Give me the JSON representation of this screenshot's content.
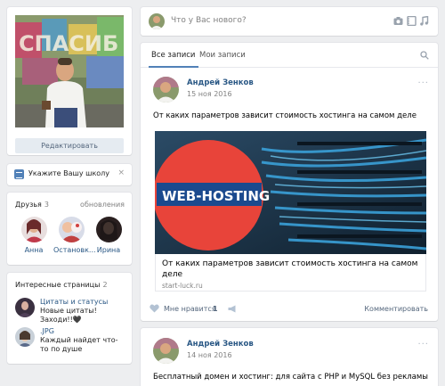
{
  "sidebar": {
    "edit_button": "Редактировать",
    "school_prompt": "Укажите Вашу школу",
    "school_close": "×",
    "friends": {
      "title": "Друзья",
      "count": "3",
      "updates": "обновления",
      "items": [
        {
          "name": "Анна"
        },
        {
          "name": "Остановк..."
        },
        {
          "name": "Ирина"
        }
      ]
    },
    "pages": {
      "title": "Интересные страницы",
      "count": "2",
      "items": [
        {
          "title": "Цитаты и статусы",
          "desc": "Новые цитаты!Заходи!!🖤"
        },
        {
          "title": ".JPG",
          "desc": "Каждый найдет что-то по душе"
        }
      ]
    }
  },
  "postbox": {
    "placeholder": "Что у Вас нового?",
    "icons": [
      "camera-icon",
      "video-icon",
      "music-icon",
      "more-icon"
    ]
  },
  "feed": {
    "tabs": [
      {
        "label": "Все записи",
        "active": true
      },
      {
        "label": "Мои записи",
        "active": false
      }
    ]
  },
  "posts": [
    {
      "author": "Андрей Зенков",
      "date": "15 ноя 2016",
      "more": "···",
      "text": "От каких параметров зависит стоимость хостинга на самом деле",
      "link": {
        "image_text": "WEB-HOSTING",
        "title": "От каких параметров зависит стоимость хостинга на самом деле",
        "domain": "start-luck.ru"
      },
      "likes_label": "Мне нравится",
      "likes_count": "1",
      "comment_label": "Комментировать"
    },
    {
      "author": "Андрей Зенков",
      "date": "14 ноя 2016",
      "more": "···",
      "text": "Бесплатный домен и хостинг: для сайта с PHP и MySQL без рекламы"
    }
  ],
  "colors": {
    "background": "#edeef0",
    "link": "#2a5885",
    "accent": "#5181b8",
    "muted": "#828282",
    "button_bg": "#e5ebf1"
  }
}
